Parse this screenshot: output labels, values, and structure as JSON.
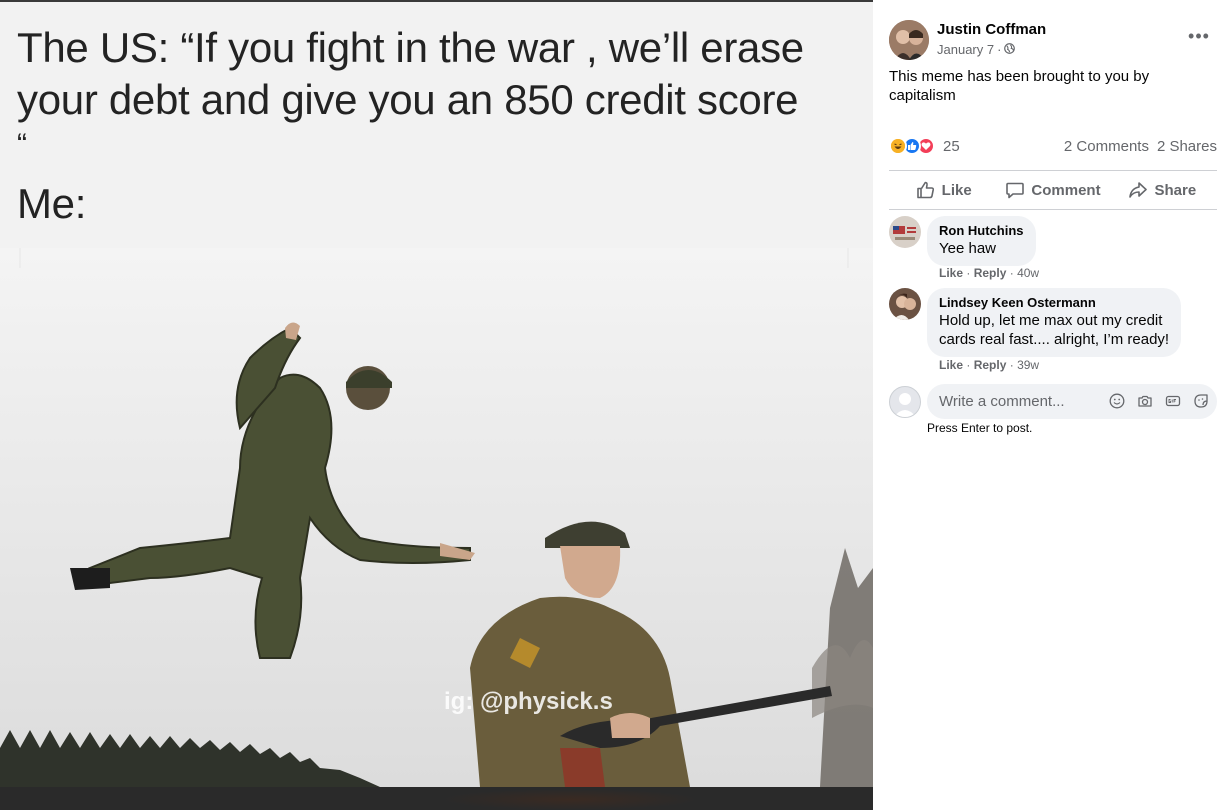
{
  "meme": {
    "caption_lines": [
      "The US: “If you fight in the war , we’ll erase",
      "your debt and give you an 850 credit score",
      "“",
      "Me:"
    ],
    "watermark": "ig: @physick.s"
  },
  "post": {
    "author": "Justin Coffman",
    "date": "January 7",
    "privacy_icon": "globe-icon",
    "more_label": "•••",
    "text": "This meme has been brought to you by capitalism",
    "reaction_icons": [
      "haha",
      "like",
      "love"
    ],
    "reaction_count": "25",
    "comments_count": "2 Comments",
    "shares_count": "2 Shares"
  },
  "actions": {
    "like": "Like",
    "comment": "Comment",
    "share": "Share"
  },
  "comments": [
    {
      "name": "Ron Hutchins",
      "text": "Yee haw",
      "like": "Like",
      "reply": "Reply",
      "time": "40w"
    },
    {
      "name": "Lindsey Keen Ostermann",
      "text_lines": [
        "Hold up, let me max out my credit",
        "cards real fast.... alright, I’m ready!"
      ],
      "like": "Like",
      "reply": "Reply",
      "time": "39w"
    }
  ],
  "composer": {
    "placeholder": "Write a comment...",
    "hint": "Press Enter to post.",
    "icons": [
      "emoji-icon",
      "camera-icon",
      "gif-icon",
      "sticker-icon"
    ]
  },
  "colors": {
    "like_blue": "#1877f2",
    "love_red": "#f33e58",
    "haha_yellow": "#f7b125",
    "secondary_text": "#65676b",
    "bubble_bg": "#f0f2f5"
  }
}
